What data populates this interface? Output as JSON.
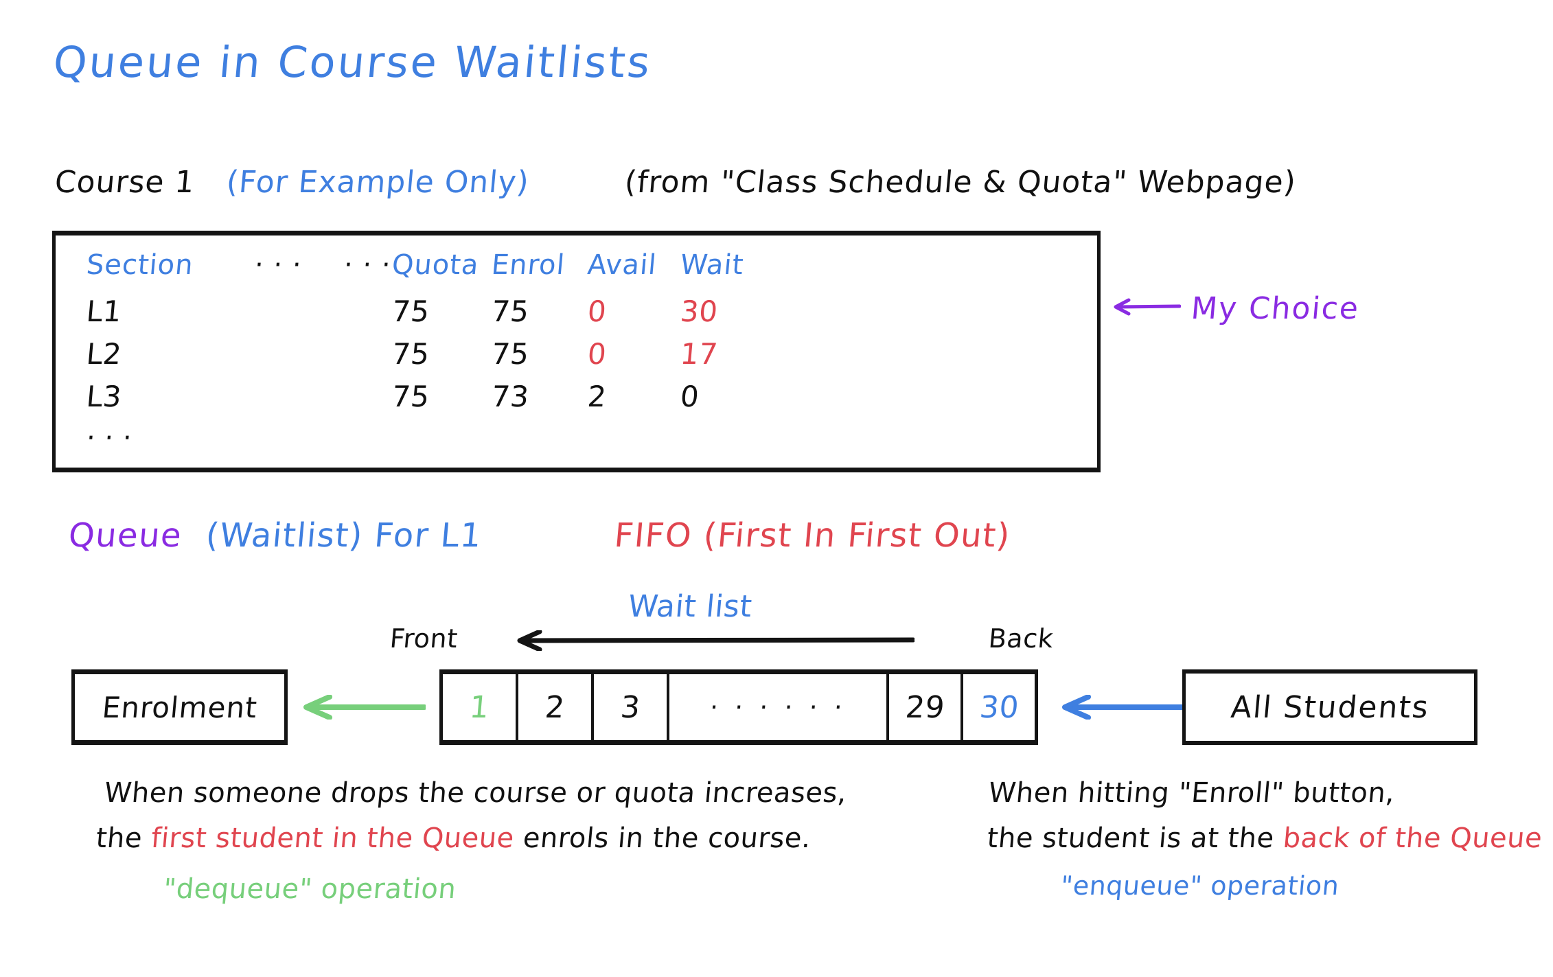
{
  "colors": {
    "black": "#111111",
    "blue": "#3f7fe0",
    "red": "#e0454f",
    "green": "#77cf7b",
    "purple": "#8a2be2",
    "background": "#ffffff"
  },
  "title": "Queue  in  Course   Waitlists",
  "subtitle": {
    "course": "Course 1",
    "example_note": "(For Example Only)",
    "source_note": "(from \"Class Schedule & Quota\" Webpage)"
  },
  "table": {
    "headers": {
      "section": "Section",
      "dots_1": "· · ·",
      "dots_2": "· · ·",
      "quota": "Quota",
      "enrol": "Enrol",
      "avail": "Avail",
      "wait": "Wait"
    },
    "rows": [
      {
        "section": "L1",
        "quota": "75",
        "enrol": "75",
        "avail": "0",
        "wait": "30",
        "avail_color": "red",
        "wait_color": "red"
      },
      {
        "section": "L2",
        "quota": "75",
        "enrol": "75",
        "avail": "0",
        "wait": "17",
        "avail_color": "red",
        "wait_color": "red"
      },
      {
        "section": "L3",
        "quota": "75",
        "enrol": "73",
        "avail": "2",
        "wait": "0",
        "avail_color": "black",
        "wait_color": "black"
      }
    ],
    "trailing_ellipsis": "· · ·"
  },
  "annotation": {
    "my_choice": "My  Choice",
    "arrow_icon": "left-arrow-icon"
  },
  "queue_heading": {
    "queue": "Queue",
    "waitlist_for": "(Waitlist) For L1",
    "fifo": "FIFO (First  In  First  Out)"
  },
  "queue_diagram": {
    "front_label": "Front",
    "back_label": "Back",
    "waitlist_label": "Wait list",
    "enrolment_box": "Enrolment",
    "students_box": "All  Students",
    "cells": [
      {
        "value": "1",
        "color": "green",
        "width": "w-norm"
      },
      {
        "value": "2",
        "color": "black",
        "width": "w-norm"
      },
      {
        "value": "3",
        "color": "black",
        "width": "w-norm"
      },
      {
        "value": "· · ·   · · ·",
        "color": "black",
        "width": "w-dots"
      },
      {
        "value": "29",
        "color": "black",
        "width": "w-29"
      },
      {
        "value": "30",
        "color": "blue",
        "width": "w-30"
      }
    ]
  },
  "notes": {
    "left": {
      "line1": "When someone  drops  the  course or  quota increases,",
      "line2_a": "the ",
      "line2_b": "first  student  in  the  Queue",
      "line2_c": " enrols in the course.",
      "line3": "\"dequeue\"  operation"
    },
    "right": {
      "line1": "When  hitting  \"Enroll\"  button,",
      "line2_a": "the  student  is at the ",
      "line2_b": "back of the Queue",
      "line3": "\"enqueue\"   operation"
    }
  }
}
